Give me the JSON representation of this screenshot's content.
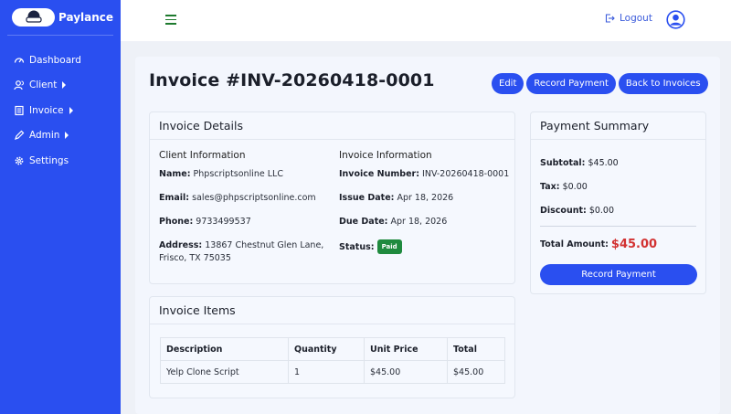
{
  "sidebar": {
    "brand": "Paylance",
    "items": [
      {
        "label": "Dashboard",
        "icon": "gauge-icon",
        "caret": false
      },
      {
        "label": "Client",
        "icon": "users-icon",
        "caret": true
      },
      {
        "label": "Invoice",
        "icon": "invoice-icon",
        "caret": true
      },
      {
        "label": "Admin",
        "icon": "pen-icon",
        "caret": true
      },
      {
        "label": "Settings",
        "icon": "gear-icon",
        "caret": false
      }
    ]
  },
  "topbar": {
    "logout_label": "Logout"
  },
  "page": {
    "title": "Invoice #INV-20260418-0001",
    "actions": {
      "edit": "Edit",
      "record_payment": "Record Payment",
      "back": "Back to Invoices"
    }
  },
  "details": {
    "heading": "Invoice Details",
    "client": {
      "title": "Client Information",
      "name_label": "Name:",
      "name": "Phpscriptsonline LLC",
      "email_label": "Email:",
      "email": "sales@phpscriptsonline.com",
      "phone_label": "Phone:",
      "phone": "9733499537",
      "address_label": "Address:",
      "address_line1": "13867 Chestnut Glen Lane,",
      "address_line2": "Frisco, TX 75035"
    },
    "invoice": {
      "title": "Invoice Information",
      "number_label": "Invoice Number:",
      "number": "INV-20260418-0001",
      "issue_label": "Issue Date:",
      "issue": "Apr 18, 2026",
      "due_label": "Due Date:",
      "due": "Apr 18, 2026",
      "status_label": "Status:",
      "status": "Paid"
    }
  },
  "items": {
    "heading": "Invoice Items",
    "columns": [
      "Description",
      "Quantity",
      "Unit Price",
      "Total"
    ],
    "rows": [
      [
        "Yelp Clone Script",
        "1",
        "$45.00",
        "$45.00"
      ]
    ]
  },
  "summary": {
    "heading": "Payment Summary",
    "subtotal_label": "Subtotal:",
    "subtotal": "$45.00",
    "tax_label": "Tax:",
    "tax": "$0.00",
    "discount_label": "Discount:",
    "discount": "$0.00",
    "total_label": "Total Amount:",
    "total": "$45.00",
    "button": "Record Payment"
  },
  "colors": {
    "primary": "#2a4ff0",
    "paid": "#1f8a3e",
    "total": "#d23232"
  }
}
